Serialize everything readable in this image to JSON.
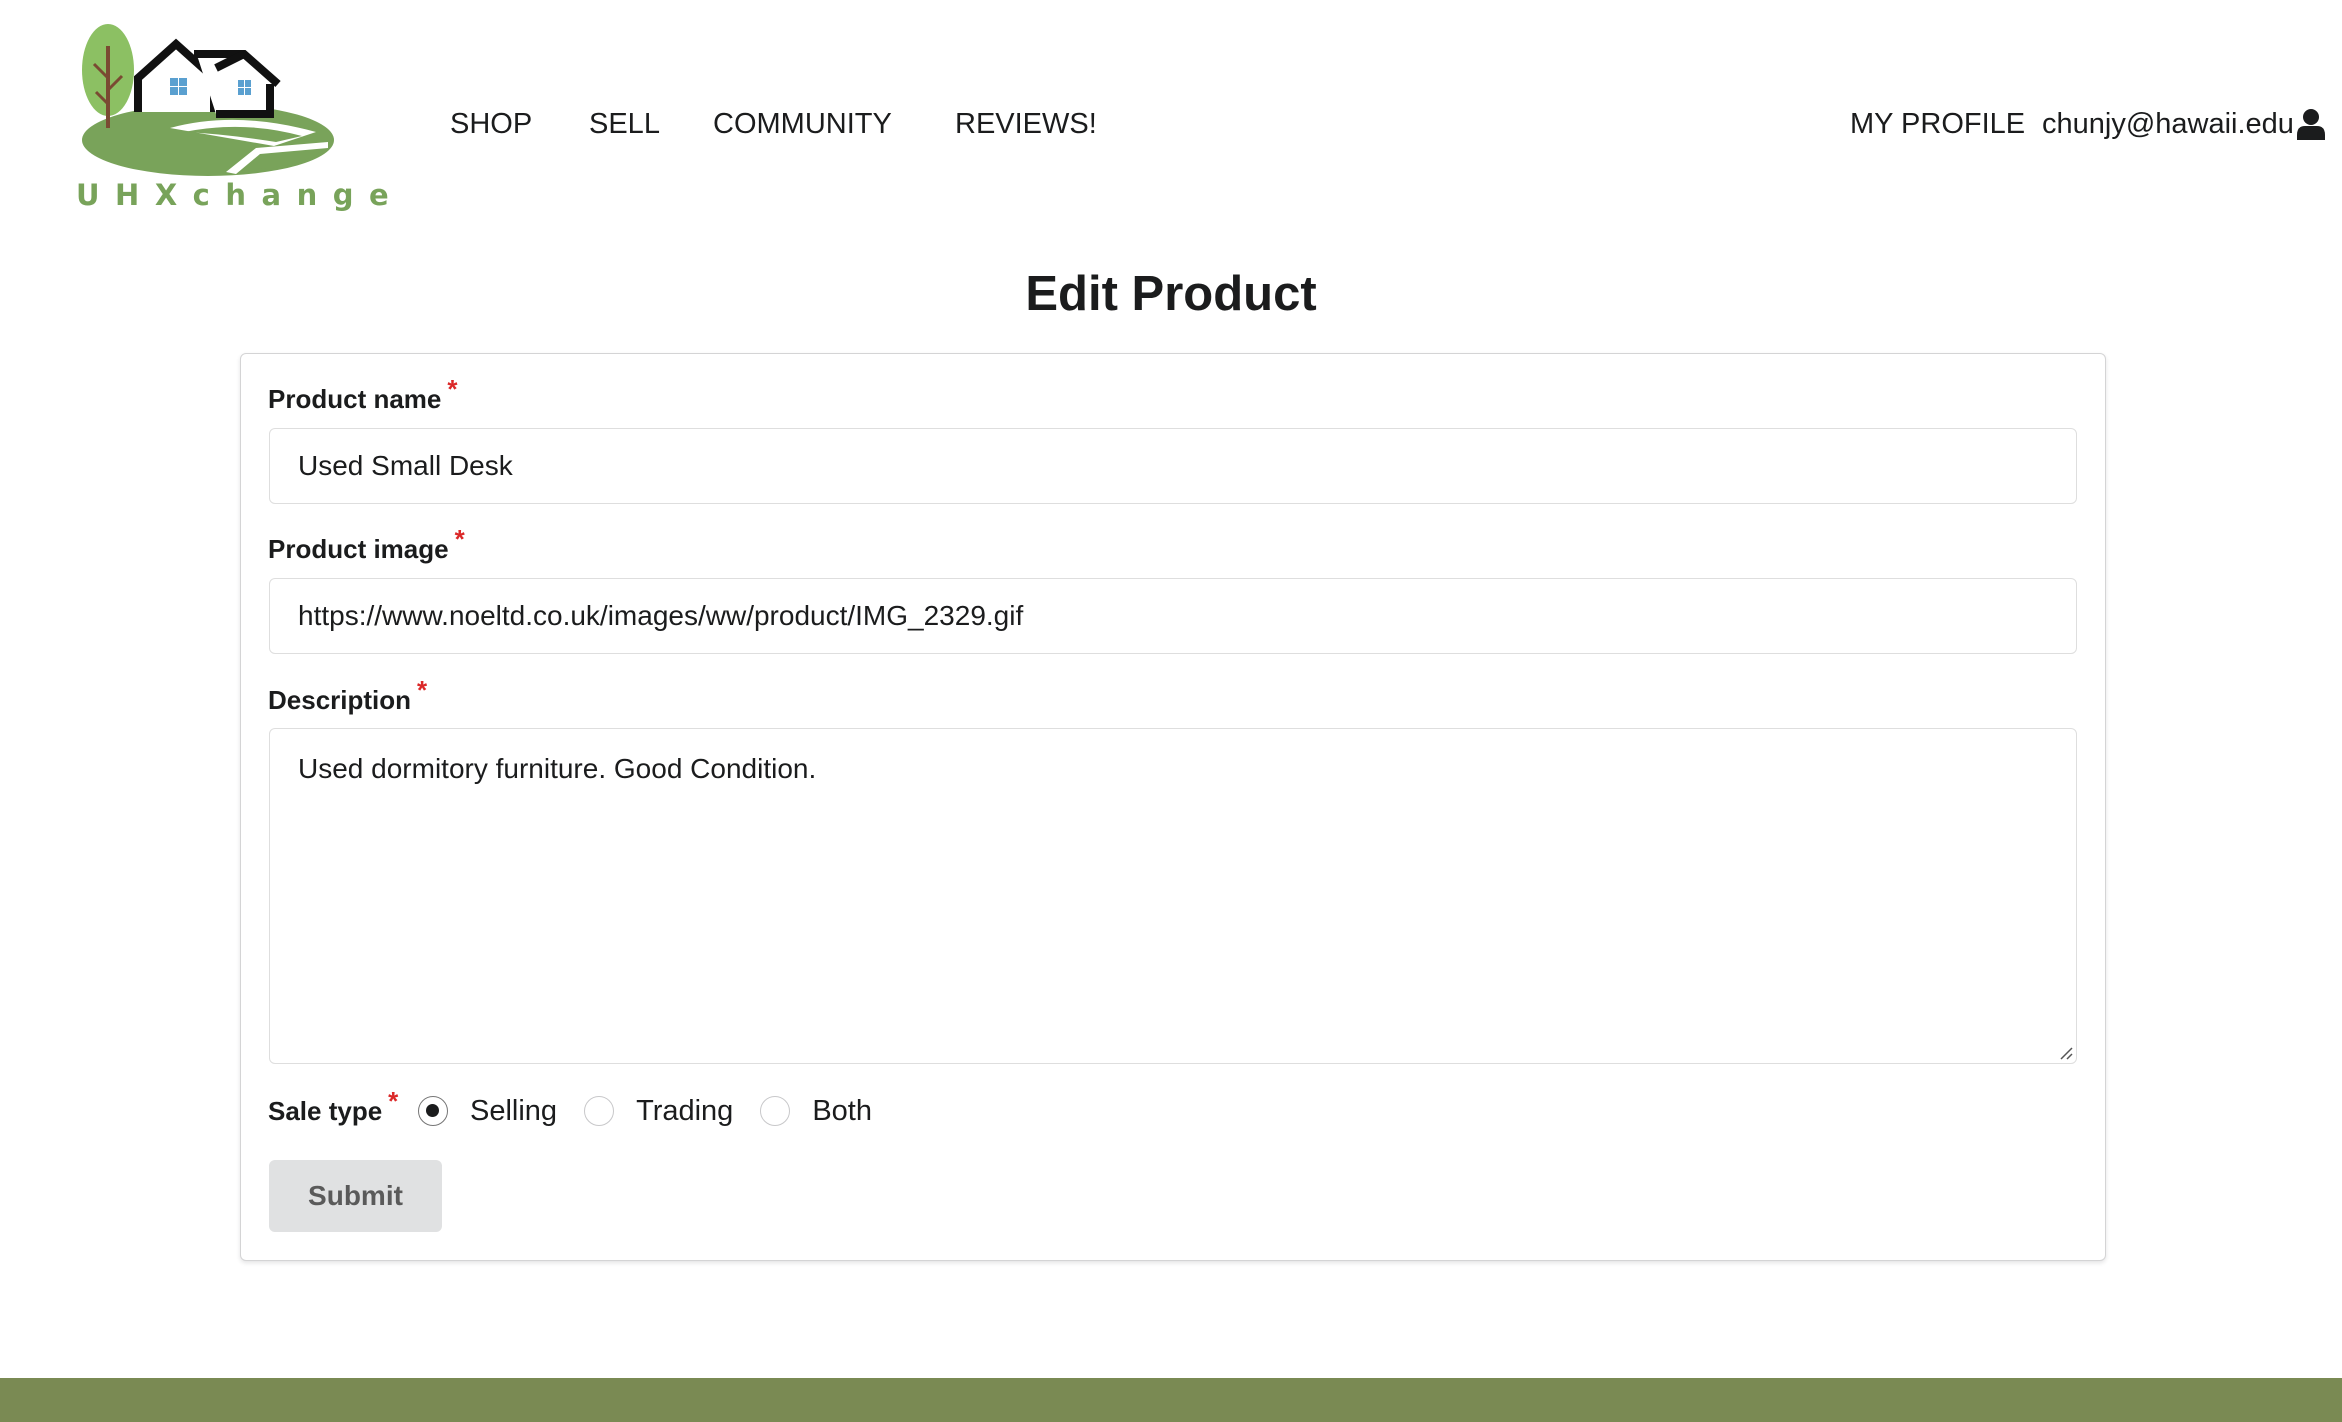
{
  "header": {
    "logo_text": "UHXchange",
    "nav": {
      "shop": "SHOP",
      "sell": "SELL",
      "community": "COMMUNITY",
      "reviews": "REVIEWS!"
    },
    "my_profile": "MY PROFILE",
    "user_email": "chunjy@hawaii.edu",
    "user_icon": "user-icon"
  },
  "page": {
    "title": "Edit Product"
  },
  "form": {
    "required_marker": "*",
    "product_name": {
      "label": "Product name",
      "value": "Used Small Desk"
    },
    "product_image": {
      "label": "Product image",
      "value": "https://www.noeltd.co.uk/images/ww/product/IMG_2329.gif"
    },
    "description": {
      "label": "Description",
      "value": "Used dormitory furniture. Good Condition."
    },
    "sale_type": {
      "label": "Sale type",
      "options": [
        "Selling",
        "Trading",
        "Both"
      ],
      "selected": "Selling"
    },
    "submit_label": "Submit"
  },
  "colors": {
    "footer": "#7a8a53",
    "logo_green": "#78a35a",
    "required": "#db2828",
    "submit_bg": "#e0e1e2"
  }
}
